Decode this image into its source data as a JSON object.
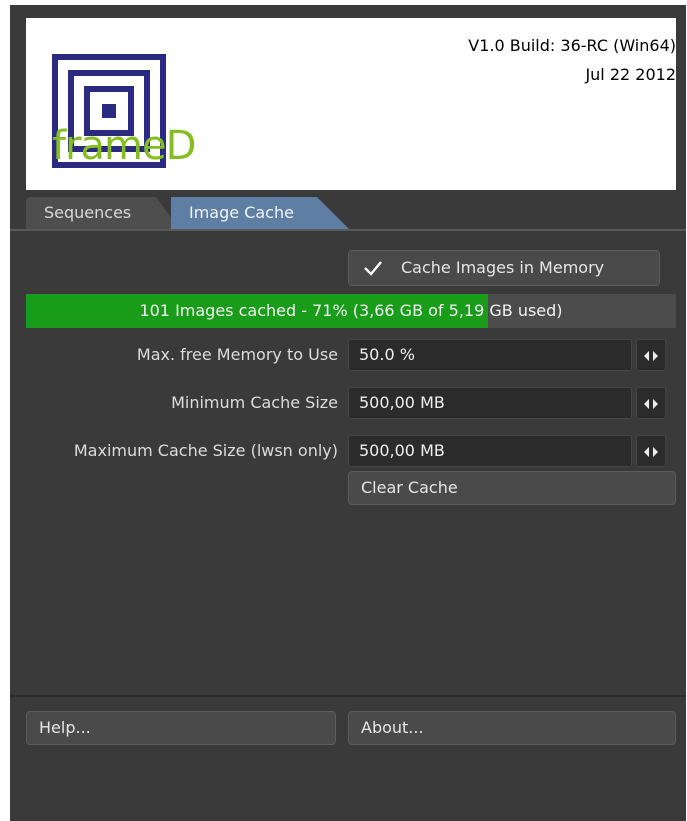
{
  "header": {
    "logo_text": "frameD",
    "version": "V1.0 Build: 36-RC (Win64)",
    "date": "Jul 22 2012"
  },
  "tabs": [
    {
      "label": "Sequences",
      "active": false
    },
    {
      "label": "Image Cache",
      "active": true
    }
  ],
  "cache": {
    "cache_checkbox_label": "Cache Images in Memory",
    "cache_checked": true,
    "progress_text": "101 Images cached - 71% (3,66 GB of 5,19 GB used)",
    "progress_fraction": 0.71,
    "fields": [
      {
        "label": "Max. free Memory to Use",
        "value": "50.0 %"
      },
      {
        "label": "Minimum Cache Size",
        "value": "500,00 MB"
      },
      {
        "label": "Maximum Cache Size (lwsn only)",
        "value": "500,00 MB"
      }
    ],
    "clear_label": "Clear Cache"
  },
  "footer": {
    "help_label": "Help...",
    "about_label": "About..."
  },
  "colors": {
    "panel_bg": "#3a3a3a",
    "active_tab": "#5e7fa3",
    "progress_green": "#199c19",
    "logo_blue": "#2a2a7e",
    "logo_green": "#84be22"
  },
  "icons": {
    "checkmark": "checkmark-icon",
    "stepper": "stepper-arrows-icon",
    "logo": "frame-logo-icon"
  }
}
